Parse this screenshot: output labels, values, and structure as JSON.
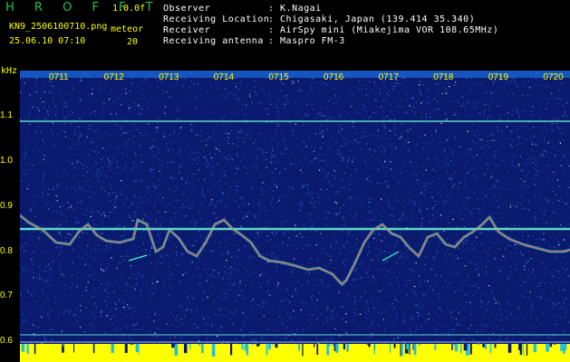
{
  "header": {
    "brand": "H R O F F T",
    "version": "1.0.0f",
    "filename": "KN9_2506100710.png",
    "datetime": "25.06.10 07:10",
    "meteor_label": "meteor",
    "meteor_count": "20",
    "info_labels": [
      "Observer",
      "Receiving Location",
      "Receiver",
      "Receiving antenna"
    ],
    "info_values": [
      ": K.Nagai",
      ": Chigasaki, Japan (139.414 35.340)",
      ": AirSpy mini (Miakejima VOR 108.65MHz)",
      ": Maspro FM-3"
    ]
  },
  "axis": {
    "unit": "kHz",
    "y_ticks": [
      "1.1",
      "1.0",
      "0.9",
      "0.8",
      "0.7",
      "0.6"
    ],
    "x_ticks": [
      "0711",
      "0712",
      "0713",
      "0714",
      "0715",
      "0716",
      "0717",
      "0718",
      "0719",
      "0720"
    ]
  },
  "colors": {
    "background": "#0a1a6e",
    "label": "#ffff00",
    "brand": "#20c050",
    "info": "#ffffff",
    "line": "#60d8c8",
    "trace": "#ff6060"
  }
}
